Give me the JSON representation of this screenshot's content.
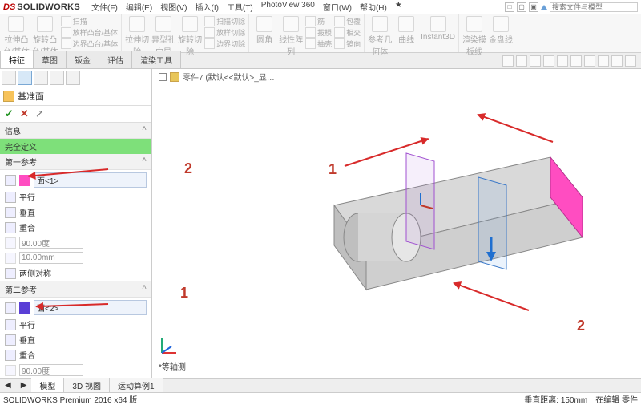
{
  "app": {
    "brand": "SOLIDWORKS"
  },
  "menu": {
    "file": "文件(F)",
    "edit": "编辑(E)",
    "view": "视图(V)",
    "insert": "插入(I)",
    "tools": "工具(T)",
    "photoview": "PhotoView 360",
    "window": "窗口(W)",
    "help": "帮助(H)",
    "star": "★"
  },
  "search": {
    "placeholder": "搜索文件与模型"
  },
  "ribbon": {
    "g1": {
      "extrude": "拉伸凸\n台/基体",
      "revolve": "旋转凸\n台/基体",
      "sweep": "扫描",
      "loft": "放样凸台/基体",
      "boundary": "边界凸台/基体"
    },
    "g2": {
      "cut_ext": "拉伸切\n除",
      "hole": "异型孔\n向导",
      "cut_rev": "旋转切\n除",
      "cut_sweep": "扫描切除",
      "cut_loft": "放样切除",
      "cut_boundary": "边界切除"
    },
    "g3": {
      "fillet": "圆角",
      "pattern": "线性阵\n列",
      "rib": "筋",
      "draft": "拔模",
      "shell": "抽壳"
    },
    "g4": {
      "wrap": "包覆",
      "intersect": "相交",
      "mirror": "镜向"
    },
    "g5": {
      "refgeo": "参考几\n何体",
      "curves": "曲线",
      "instant": "Instant3D"
    },
    "g6": {
      "render": "渲染摸\n板线",
      "coll": "金盘线"
    }
  },
  "tabs": {
    "feature": "特征",
    "sketch": "草图",
    "sheetmetal": "钣金",
    "evaluate": "评估",
    "render": "渲染工具"
  },
  "pm": {
    "title": "基准面",
    "ok": "✓",
    "cancel": "✕",
    "push": "↗",
    "sections": {
      "info": "信息",
      "status": "完全定义",
      "first_ref": "第一参考",
      "second_ref": "第二参考"
    },
    "ref1": {
      "face": "面<1>",
      "parallel": "平行",
      "perp": "垂直",
      "coincident": "重合",
      "angle": "90.00度",
      "dist": "10.00mm",
      "sym": "两侧对称"
    },
    "ref2": {
      "face": "面<2>",
      "parallel": "平行",
      "perp": "垂直",
      "coincident": "重合",
      "angle": "90.00度"
    }
  },
  "doc": {
    "title": "零件7 (默认<<默认>_显…"
  },
  "viewport": {
    "iso_label": "*等轴测"
  },
  "annotations": {
    "a1": "1",
    "a2": "2"
  },
  "bottom_tabs": {
    "model": "模型",
    "view3d": "3D 视图",
    "motion": "运动算例1"
  },
  "status": {
    "product": "SOLIDWORKS Premium 2016 x64 版",
    "dist_label": "垂直距离:",
    "dist_val": "150mm",
    "edit": "在编辑 零件"
  }
}
